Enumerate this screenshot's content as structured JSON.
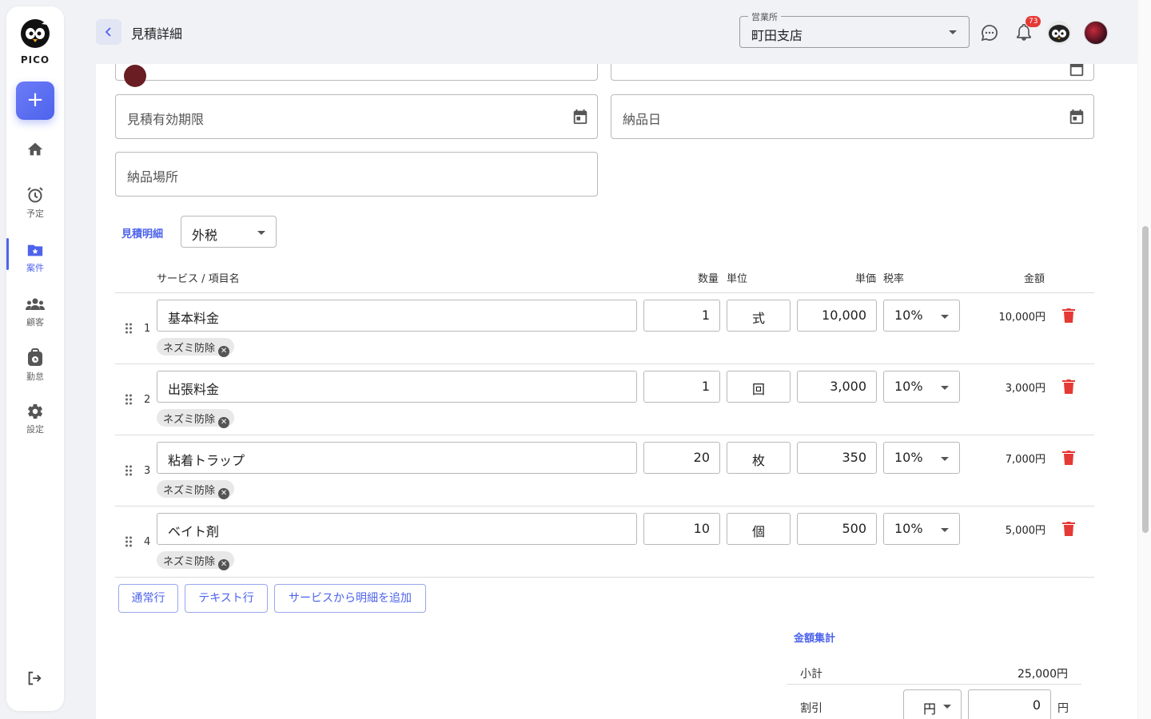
{
  "app": {
    "logo_text": "PICO"
  },
  "sidebar": {
    "items": [
      {
        "label": "",
        "icon": "home-icon"
      },
      {
        "label": "予定",
        "icon": "alarm-clock-icon"
      },
      {
        "label": "案件",
        "icon": "folder-star-icon"
      },
      {
        "label": "顧客",
        "icon": "people-icon"
      },
      {
        "label": "勤怠",
        "icon": "timecard-icon"
      },
      {
        "label": "設定",
        "icon": "gear-icon"
      }
    ],
    "add_label": "+"
  },
  "header": {
    "back_label": "<",
    "title": "見積詳細",
    "office_label": "営業所",
    "office_value": "町田支店",
    "notification_count": "73"
  },
  "form": {
    "expiry_placeholder": "見積有効期限",
    "delivery_date_placeholder": "納品日",
    "delivery_place_placeholder": "納品場所"
  },
  "details": {
    "section_label": "見積明細",
    "tax_mode": "外税",
    "columns": {
      "name": "サービス / 項目名",
      "qty": "数量",
      "unit": "単位",
      "price": "単価",
      "tax": "税率",
      "amount": "金額"
    },
    "rows": [
      {
        "num": "1",
        "name": "基本料金",
        "qty": "1",
        "unit": "式",
        "price": "10,000",
        "tax": "10%",
        "amount": "10,000円",
        "tag": "ネズミ防除"
      },
      {
        "num": "2",
        "name": "出張料金",
        "qty": "1",
        "unit": "回",
        "price": "3,000",
        "tax": "10%",
        "amount": "3,000円",
        "tag": "ネズミ防除"
      },
      {
        "num": "3",
        "name": "粘着トラップ",
        "qty": "20",
        "unit": "枚",
        "price": "350",
        "tax": "10%",
        "amount": "7,000円",
        "tag": "ネズミ防除"
      },
      {
        "num": "4",
        "name": "ベイト剤",
        "qty": "10",
        "unit": "個",
        "price": "500",
        "tax": "10%",
        "amount": "5,000円",
        "tag": "ネズミ防除"
      }
    ],
    "buttons": {
      "normal_row": "通常行",
      "text_row": "テキスト行",
      "add_from_service": "サービスから明細を追加"
    }
  },
  "summary": {
    "section_label": "金額集計",
    "subtotal_label": "小計",
    "subtotal_value": "25,000円",
    "discount_label": "割引",
    "discount_unit": "円",
    "discount_value": "0",
    "discount_suffix": "円"
  },
  "colors": {
    "accent": "#4d63ec",
    "danger": "#e53935"
  }
}
